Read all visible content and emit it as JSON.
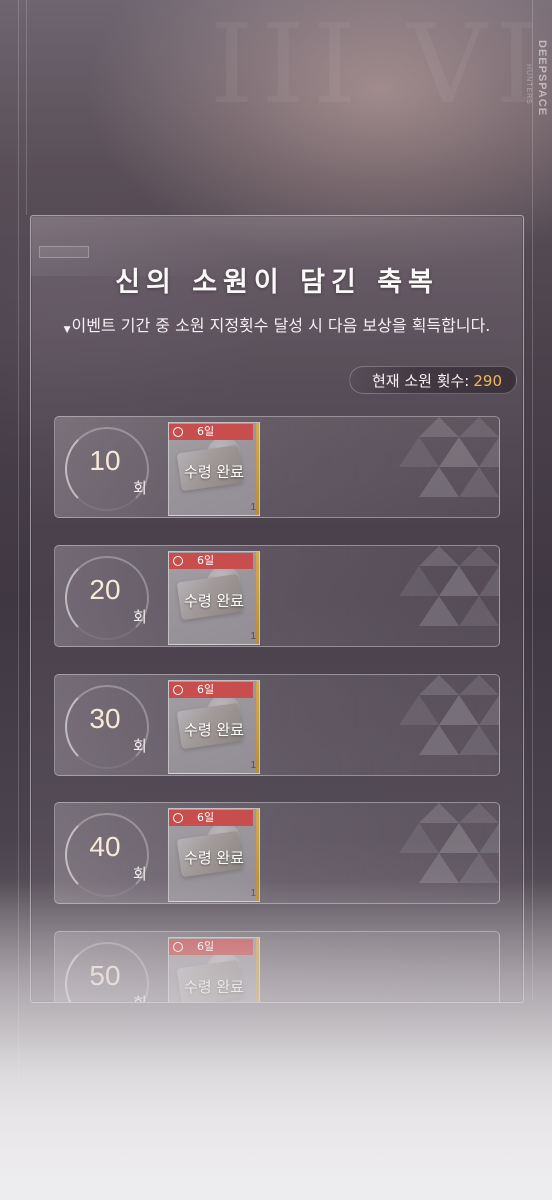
{
  "brand": {
    "name": "DEEPSPACE",
    "sub": "HUNTERS"
  },
  "event": {
    "title": "신의 소원이 담긴 축복",
    "description_mark": "▼",
    "description": "이벤트 기간 중 소원 지정횟수 달성 시 다음 보상을 획득합니다.",
    "count_label": "현재 소원 횟수:",
    "count_value": "290"
  },
  "rewards": [
    {
      "milestone": "10",
      "unit": "회",
      "duration": "6일",
      "status": "수령 완료",
      "quantity": "1"
    },
    {
      "milestone": "20",
      "unit": "회",
      "duration": "6일",
      "status": "수령 완료",
      "quantity": "1"
    },
    {
      "milestone": "30",
      "unit": "회",
      "duration": "6일",
      "status": "수령 완료",
      "quantity": "1"
    },
    {
      "milestone": "40",
      "unit": "회",
      "duration": "6일",
      "status": "수령 완료",
      "quantity": "1"
    },
    {
      "milestone": "50",
      "unit": "회",
      "duration": "6일",
      "status": "수령 완료",
      "quantity": "1"
    }
  ],
  "colors": {
    "accent": "#f0b65a",
    "tag": "#c84e4e"
  }
}
